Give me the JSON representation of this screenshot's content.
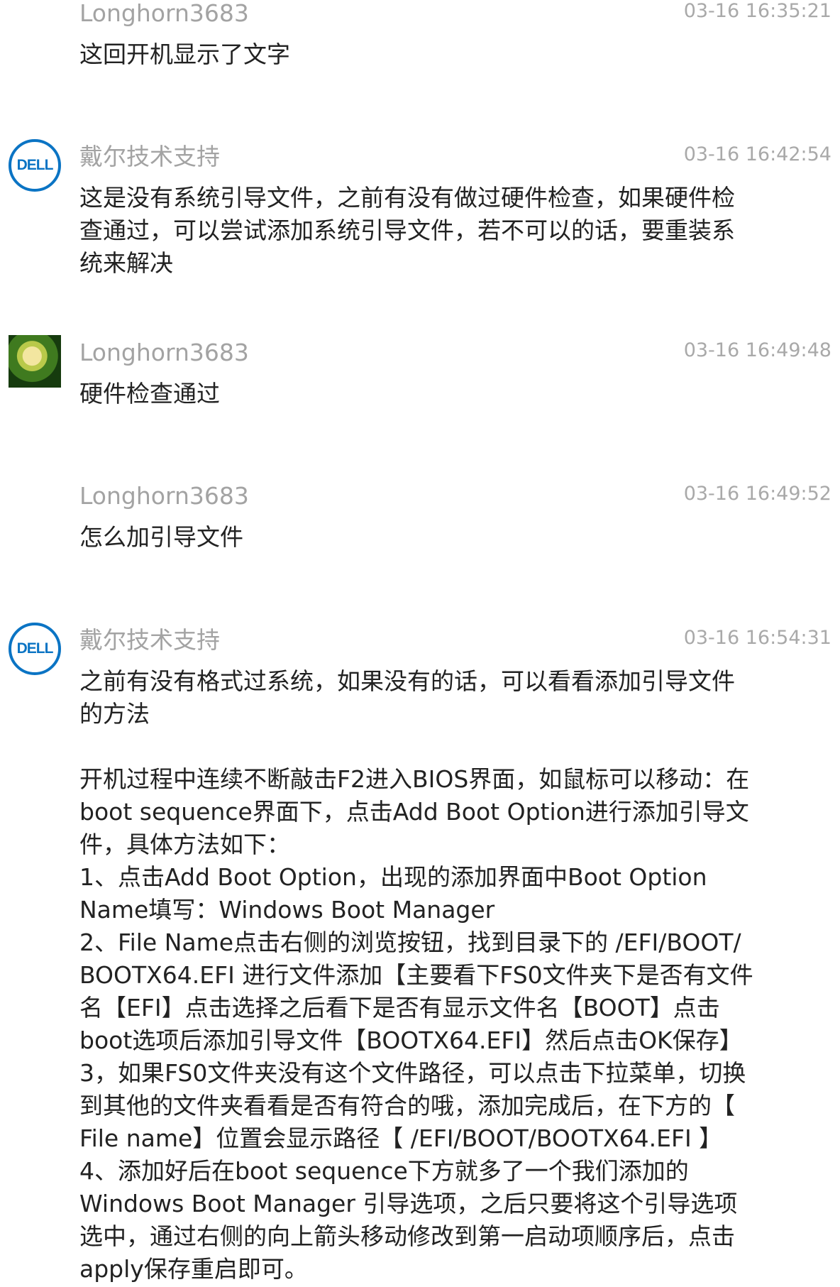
{
  "messages": [
    {
      "sender": "Longhorn3683",
      "time": "03-16 16:35:21",
      "avatar": "none",
      "text": "这回开机显示了文字"
    },
    {
      "sender": "戴尔技术支持",
      "time": "03-16 16:42:54",
      "avatar": "dell-logo",
      "avatar_text": "DELL",
      "text": "这是没有系统引导文件，之前有没有做过硬件检查，如果硬件检\n查通过，可以尝试添加系统引导文件，若不可以的话，要重装系\n统来解决"
    },
    {
      "sender": "Longhorn3683",
      "time": "03-16 16:49:48",
      "avatar": "user-photo",
      "text": "硬件检查通过"
    },
    {
      "sender": "Longhorn3683",
      "time": "03-16 16:49:52",
      "avatar": "none",
      "text": "怎么加引导文件"
    },
    {
      "sender": "戴尔技术支持",
      "time": "03-16 16:54:31",
      "avatar": "dell-logo",
      "avatar_text": "DELL",
      "text": "之前有没有格式过系统，如果没有的话，可以看看添加引导文件\n的方法\n\n开机过程中连续不断敲击F2进入BIOS界面，如鼠标可以移动：在\nboot sequence界面下，点击Add Boot Option进行添加引导文\n件，具体方法如下：\n1、点击Add Boot Option，出现的添加界面中Boot Option\nName填写：Windows Boot Manager\n2、File Name点击右侧的浏览按钮，找到目录下的 /EFI/BOOT/\nBOOTX64.EFI 进行文件添加【主要看下FS0文件夹下是否有文件\n名【EFI】点击选择之后看下是否有显示文件名【BOOT】点击\nboot选项后添加引导文件【BOOTX64.EFI】然后点击OK保存】\n3，如果FS0文件夹没有这个文件路径，可以点击下拉菜单，切换\n到其他的文件夹看看是否有符合的哦，添加完成后，在下方的【\nFile name】位置会显示路径【 /EFI/BOOT/BOOTX64.EFI 】\n4、添加好后在boot sequence下方就多了一个我们添加的\nWindows Boot Manager 引导选项，之后只要将这个引导选项\n选中，通过右侧的向上箭头移动修改到第一启动项顺序后，点击\napply保存重启即可。"
    }
  ],
  "colors": {
    "dell_blue": "#0b74c4",
    "meta_gray": "#a3a3a3",
    "text": "#222222"
  }
}
